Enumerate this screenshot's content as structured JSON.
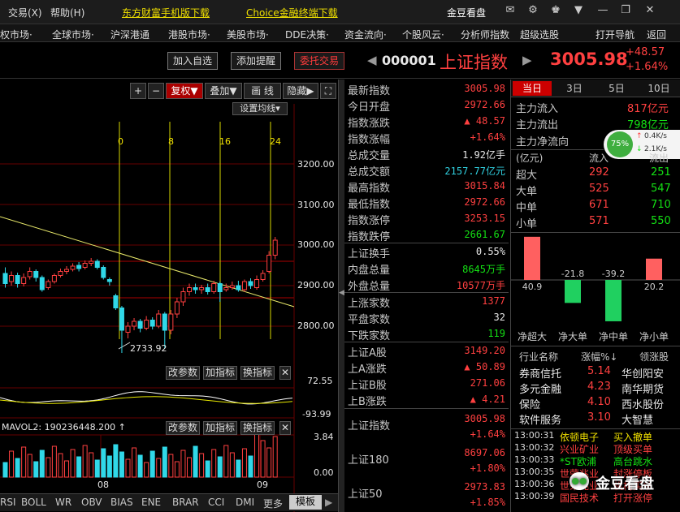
{
  "titlebar": {
    "menu": [
      "交易(Ⅹ)",
      "帮助(H)"
    ],
    "links": [
      "东方财富手机版下载",
      "Choice金融终端下载"
    ],
    "right_label": "金豆看盘",
    "win_icons": [
      "mail-icon",
      "gear-icon",
      "shirt-icon",
      "minimize-icon",
      "restore-icon",
      "close-icon"
    ]
  },
  "navbar": {
    "items": [
      "股权市场·",
      "全球市场·",
      "沪深港通",
      "港股市场·",
      "美股市场·",
      "DDE决策·",
      "资金流向·",
      "个股风云·",
      "分析师指数",
      "超级选股",
      "打开导航",
      "返回"
    ]
  },
  "actions": {
    "add_watch": "加入自选",
    "add_alert": "添加提醒",
    "trade": "委托交易"
  },
  "index": {
    "code": "000001",
    "name": "上证指数",
    "price": "3005.98",
    "change": "+48.57",
    "pct": "+1.64%"
  },
  "toolbar": {
    "plus": "+",
    "minus": "−",
    "fuquan": "复权▼",
    "overlay": "叠加▼",
    "line": "画 线",
    "hide": "隐藏▶",
    "fullscreen": "⛶",
    "ma_setting": "设置均线▾"
  },
  "kchart": {
    "y_ticks": [
      "3200.00",
      "3100.00",
      "3000.00",
      "2900.00",
      "2800.00"
    ],
    "time_marks": [
      "0",
      "8",
      "16",
      "24"
    ],
    "low_label": "2733.92",
    "candles": [
      {
        "o": 2930,
        "c": 2905,
        "h": 2945,
        "l": 2895
      },
      {
        "o": 2910,
        "c": 2925,
        "h": 2935,
        "l": 2900
      },
      {
        "o": 2925,
        "c": 2905,
        "h": 2932,
        "l": 2895
      },
      {
        "o": 2905,
        "c": 2920,
        "h": 2930,
        "l": 2898
      },
      {
        "o": 2922,
        "c": 2935,
        "h": 2945,
        "l": 2915
      },
      {
        "o": 2935,
        "c": 2920,
        "h": 2940,
        "l": 2910
      },
      {
        "o": 2920,
        "c": 2890,
        "h": 2925,
        "l": 2885
      },
      {
        "o": 2895,
        "c": 2910,
        "h": 2915,
        "l": 2890
      },
      {
        "o": 2910,
        "c": 2925,
        "h": 2930,
        "l": 2905
      },
      {
        "o": 2925,
        "c": 2935,
        "h": 2942,
        "l": 2920
      },
      {
        "o": 2935,
        "c": 2940,
        "h": 2948,
        "l": 2928
      },
      {
        "o": 2940,
        "c": 2948,
        "h": 2955,
        "l": 2935
      },
      {
        "o": 2950,
        "c": 2942,
        "h": 2958,
        "l": 2935
      },
      {
        "o": 2945,
        "c": 2955,
        "h": 2962,
        "l": 2940
      },
      {
        "o": 2955,
        "c": 2960,
        "h": 2968,
        "l": 2948
      },
      {
        "o": 2960,
        "c": 2945,
        "h": 2965,
        "l": 2940
      },
      {
        "o": 2945,
        "c": 2920,
        "h": 2950,
        "l": 2915
      },
      {
        "o": 2915,
        "c": 2910,
        "h": 2920,
        "l": 2900
      },
      {
        "o": 2875,
        "c": 2845,
        "h": 2880,
        "l": 2840
      },
      {
        "o": 2845,
        "c": 2790,
        "h": 2850,
        "l": 2734
      },
      {
        "o": 2785,
        "c": 2800,
        "h": 2810,
        "l": 2770
      },
      {
        "o": 2800,
        "c": 2812,
        "h": 2820,
        "l": 2790
      },
      {
        "o": 2812,
        "c": 2795,
        "h": 2818,
        "l": 2785
      },
      {
        "o": 2795,
        "c": 2815,
        "h": 2825,
        "l": 2790
      },
      {
        "o": 2815,
        "c": 2800,
        "h": 2822,
        "l": 2792
      },
      {
        "o": 2800,
        "c": 2830,
        "h": 2840,
        "l": 2795
      },
      {
        "o": 2830,
        "c": 2790,
        "h": 2835,
        "l": 2745
      },
      {
        "o": 2790,
        "c": 2830,
        "h": 2840,
        "l": 2780
      },
      {
        "o": 2830,
        "c": 2860,
        "h": 2870,
        "l": 2820
      },
      {
        "o": 2860,
        "c": 2885,
        "h": 2895,
        "l": 2850
      },
      {
        "o": 2885,
        "c": 2895,
        "h": 2905,
        "l": 2875
      },
      {
        "o": 2895,
        "c": 2890,
        "h": 2905,
        "l": 2880
      },
      {
        "o": 2890,
        "c": 2895,
        "h": 2902,
        "l": 2880
      },
      {
        "o": 2895,
        "c": 2885,
        "h": 2905,
        "l": 2878
      },
      {
        "o": 2885,
        "c": 2905,
        "h": 2912,
        "l": 2880
      },
      {
        "o": 2905,
        "c": 2885,
        "h": 2910,
        "l": 2860
      },
      {
        "o": 2890,
        "c": 2895,
        "h": 2905,
        "l": 2885
      },
      {
        "o": 2895,
        "c": 2900,
        "h": 2910,
        "l": 2890
      },
      {
        "o": 2900,
        "c": 2890,
        "h": 2912,
        "l": 2885
      },
      {
        "o": 2890,
        "c": 2910,
        "h": 2915,
        "l": 2885
      },
      {
        "o": 2910,
        "c": 2900,
        "h": 2918,
        "l": 2892
      },
      {
        "o": 2895,
        "c": 2915,
        "h": 2925,
        "l": 2890
      },
      {
        "o": 2915,
        "c": 2930,
        "h": 2938,
        "l": 2910
      },
      {
        "o": 2935,
        "c": 2975,
        "h": 2985,
        "l": 2930
      },
      {
        "o": 2975,
        "c": 3012,
        "h": 3020,
        "l": 2965
      }
    ]
  },
  "osc": {
    "reset": "改参数",
    "add": "加指标",
    "switch": "换指标",
    "close": "✕",
    "top": "72.55",
    "bottom": "-93.99"
  },
  "vol": {
    "label": "MAVOL2: 190236448.200 ↑",
    "reset": "改参数",
    "add": "加指标",
    "switch": "换指标",
    "close": "✕",
    "v1": "3.84",
    "v2": "0.00",
    "x1": "08",
    "x2": "09"
  },
  "bottom_tabs": [
    "RSI",
    "BOLL",
    "WR",
    "OBV",
    "BIAS",
    "ENE",
    "BRAR",
    "CCI",
    "DMI",
    "更多",
    "模板"
  ],
  "quote": [
    {
      "k": "最新指数",
      "v": "3005.98",
      "c": "red"
    },
    {
      "k": "今日开盘",
      "v": "2972.66",
      "c": "red"
    },
    {
      "k": "指数涨跌",
      "v": "▲ 48.57",
      "c": "red"
    },
    {
      "k": "指数涨幅",
      "v": "+1.64%",
      "c": "red"
    },
    {
      "k": "总成交量",
      "v": "1.92亿手",
      "c": "white"
    },
    {
      "k": "总成交额",
      "v": "2157.77亿元",
      "c": "cyan"
    },
    {
      "k": "最高指数",
      "v": "3015.84",
      "c": "red"
    },
    {
      "k": "最低指数",
      "v": "2972.66",
      "c": "red"
    },
    {
      "k": "指数涨停",
      "v": "3253.15",
      "c": "red"
    },
    {
      "k": "指数跌停",
      "v": "2661.67",
      "c": "green"
    },
    {
      "k": "上证换手",
      "v": "0.55%",
      "c": "white"
    },
    {
      "k": "内盘总量",
      "v": "8645万手",
      "c": "green"
    },
    {
      "k": "外盘总量",
      "v": "10577万手",
      "c": "red"
    },
    {
      "k": "上涨家数",
      "v": "1377",
      "c": "red"
    },
    {
      "k": "平盘家数",
      "v": "32",
      "c": "white"
    },
    {
      "k": "下跌家数",
      "v": "119",
      "c": "green"
    },
    {
      "k": "上证A股",
      "v": "3149.20",
      "c": "red"
    },
    {
      "k": "上A涨跌",
      "v": "▲ 50.89",
      "c": "red"
    },
    {
      "k": "上证B股",
      "v": "271.06",
      "c": "red"
    },
    {
      "k": "上B涨跌",
      "v": "▲ 4.21",
      "c": "red"
    }
  ],
  "related": [
    {
      "k": "上证指数",
      "v1": "3005.98",
      "v2": "+1.64%"
    },
    {
      "k": "上证180",
      "v1": "8697.06",
      "v2": "+1.80%"
    },
    {
      "k": "上证50",
      "v1": "2973.83",
      "v2": "+1.85%"
    }
  ],
  "flow": {
    "tabs": [
      "当日",
      "3日",
      "5日",
      "10日"
    ],
    "inflow_label": "主力流入",
    "inflow": "817亿元",
    "outflow_label": "主力流出",
    "outflow": "798亿元",
    "net_label": "主力净流向",
    "badge": "75%",
    "speed_up": "0.4K/s",
    "speed_down": "2.1K/s",
    "hdr": [
      "(亿元)",
      "流入",
      "流出"
    ],
    "rows": [
      {
        "k": "超大",
        "in": "292",
        "out": "251"
      },
      {
        "k": "大单",
        "in": "525",
        "out": "547"
      },
      {
        "k": "中单",
        "in": "671",
        "out": "710"
      },
      {
        "k": "小单",
        "in": "571",
        "out": "550"
      }
    ],
    "bars": [
      {
        "label": "净超大",
        "value": 40.9
      },
      {
        "label": "净大单",
        "value": -21.8
      },
      {
        "label": "净中单",
        "value": -39.2
      },
      {
        "label": "净小单",
        "value": 20.2
      }
    ],
    "sector_hdr": [
      "行业名称",
      "涨幅%↓",
      "领涨股"
    ],
    "sectors": [
      {
        "n": "券商信托",
        "p": "5.14",
        "l": "华创阳安"
      },
      {
        "n": "多元金融",
        "p": "4.23",
        "l": "南华期货"
      },
      {
        "n": "保险",
        "p": "4.10",
        "l": "西水股份"
      },
      {
        "n": "软件服务",
        "p": "3.10",
        "l": "大智慧"
      }
    ],
    "ticks": [
      {
        "t": "13:00:31",
        "s": "依顿电子",
        "e": "买入撤单",
        "sc": "yel",
        "ec": "yel"
      },
      {
        "t": "13:00:32",
        "s": "兴业矿业",
        "e": "顶级买单",
        "sc": "red",
        "ec": "red"
      },
      {
        "t": "13:00:33",
        "s": "*ST欧浦",
        "e": "高台跳水",
        "sc": "green",
        "ec": "green"
      },
      {
        "t": "13:00:35",
        "s": "世荣兆业",
        "e": "封涨停板",
        "sc": "red",
        "ec": "red"
      },
      {
        "t": "13:00:36",
        "s": "世荣兆业",
        "e": "机构买单",
        "sc": "red",
        "ec": "red"
      },
      {
        "t": "13:00:39",
        "s": "国民技术",
        "e": "打开涨停",
        "sc": "red",
        "ec": "red"
      }
    ],
    "watermark": "金豆看盘"
  }
}
